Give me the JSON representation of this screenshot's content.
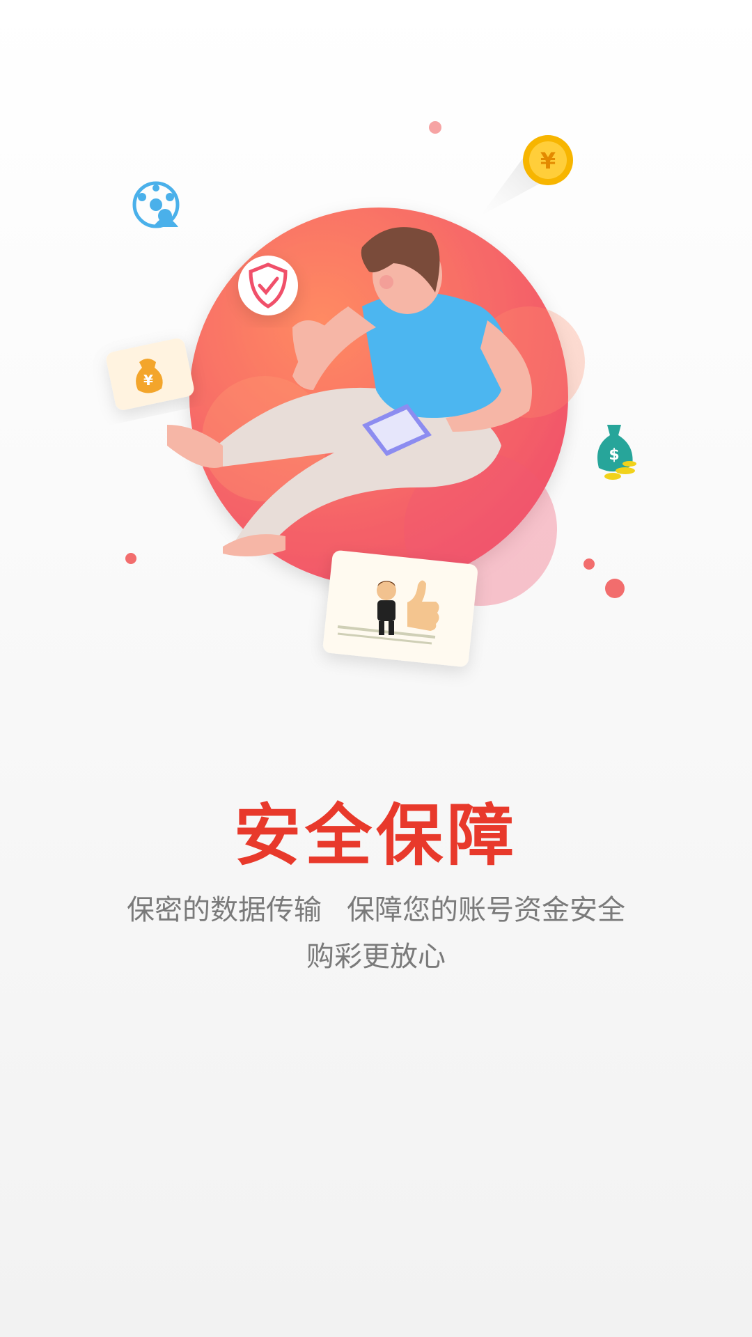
{
  "onboarding": {
    "title": "安全保障",
    "desc_left": "保密的数据传输",
    "desc_right": "保障您的账号资金安全",
    "desc_line2": "购彩更放心"
  },
  "colors": {
    "accent": "#e8392b",
    "circle": "#f46a5c",
    "shirt": "#4cb6f0",
    "coin": "#f7b500",
    "text_secondary": "#7a7a7a"
  },
  "icons": [
    "security-shield-icon",
    "yuan-coin-icon",
    "soccer-ball-user-icon",
    "money-bag-icon",
    "dollar-bag-icon",
    "thumbs-up-card-icon",
    "tablet-icon"
  ],
  "coin_symbol": "¥",
  "dollar_symbol": "$"
}
